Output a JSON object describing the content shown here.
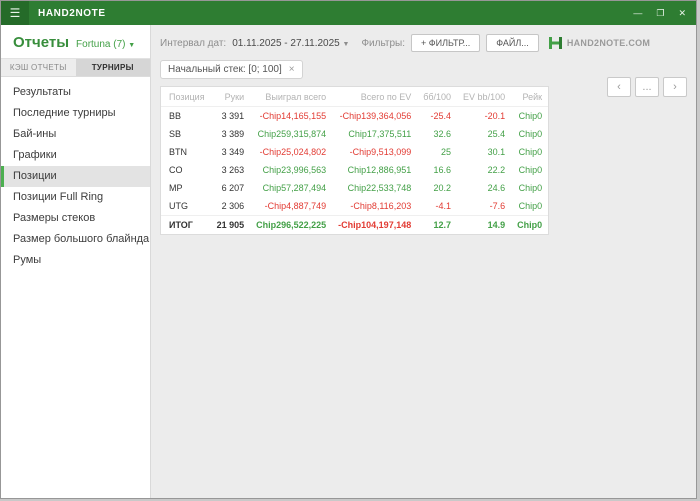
{
  "titlebar": {
    "title": "HAND2NOTE"
  },
  "icons": {
    "hamburger": "☰",
    "minimize": "—",
    "maximize": "❐",
    "close": "✕",
    "chevron_down": "▼",
    "chip_close": "×",
    "prev": "‹",
    "more": "...",
    "next": "›"
  },
  "colors": {
    "titlebar_green": "#2e7d32",
    "accent_green": "#43a047",
    "negative_red": "#e23b33"
  },
  "sidebar": {
    "title": "Отчеты",
    "room_selector": "Fortuna (7)",
    "tabs": [
      {
        "label": "КЭШ ОТЧЕТЫ",
        "active": false
      },
      {
        "label": "ТУРНИРЫ",
        "active": true
      }
    ],
    "items": [
      {
        "label": "Результаты",
        "selected": false
      },
      {
        "label": "Последние турниры",
        "selected": false
      },
      {
        "label": "Бай-ины",
        "selected": false
      },
      {
        "label": "Графики",
        "selected": false
      },
      {
        "label": "Позиции",
        "selected": true
      },
      {
        "label": "Позиции Full Ring",
        "selected": false
      },
      {
        "label": "Размеры стеков",
        "selected": false
      },
      {
        "label": "Размер большого блайнда",
        "selected": false
      },
      {
        "label": "Румы",
        "selected": false
      }
    ]
  },
  "toolbar": {
    "interval_label": "Интервал дат:",
    "interval_value": "01.11.2025 - 27.11.2025",
    "filters_label": "Фильтры:",
    "add_filter_button": "+ ФИЛЬТР...",
    "file_button": "ФАЙЛ...",
    "brand": "HAND2NOTE.COM"
  },
  "filter_chip": {
    "label": "Начальный стек: [0; 100]"
  },
  "table": {
    "columns": [
      "Позиция",
      "Руки",
      "Выиграл всего",
      "Всего по EV",
      "бб/100",
      "EV bb/100",
      "Рейк"
    ],
    "rows": [
      {
        "position": "BB",
        "hands": "3 391",
        "won": "-Chip14,165,155",
        "ev_total": "-Chip139,364,056",
        "bb100": "-25.4",
        "ev_bb100": "-20.1",
        "rake": "Chip0",
        "total": false
      },
      {
        "position": "SB",
        "hands": "3 389",
        "won": "Chip259,315,874",
        "ev_total": "Chip17,375,511",
        "bb100": "32.6",
        "ev_bb100": "25.4",
        "rake": "Chip0",
        "total": false
      },
      {
        "position": "BTN",
        "hands": "3 349",
        "won": "-Chip25,024,802",
        "ev_total": "-Chip9,513,099",
        "bb100": "25",
        "ev_bb100": "30.1",
        "rake": "Chip0",
        "total": false
      },
      {
        "position": "CO",
        "hands": "3 263",
        "won": "Chip23,996,563",
        "ev_total": "Chip12,886,951",
        "bb100": "16.6",
        "ev_bb100": "22.2",
        "rake": "Chip0",
        "total": false
      },
      {
        "position": "MP",
        "hands": "6 207",
        "won": "Chip57,287,494",
        "ev_total": "Chip22,533,748",
        "bb100": "20.2",
        "ev_bb100": "24.6",
        "rake": "Chip0",
        "total": false
      },
      {
        "position": "UTG",
        "hands": "2 306",
        "won": "-Chip4,887,749",
        "ev_total": "-Chip8,116,203",
        "bb100": "-4.1",
        "ev_bb100": "-7.6",
        "rake": "Chip0",
        "total": false
      },
      {
        "position": "ИТОГ",
        "hands": "21 905",
        "won": "Chip296,522,225",
        "ev_total": "-Chip104,197,148",
        "bb100": "12.7",
        "ev_bb100": "14.9",
        "rake": "Chip0",
        "total": true
      }
    ]
  }
}
